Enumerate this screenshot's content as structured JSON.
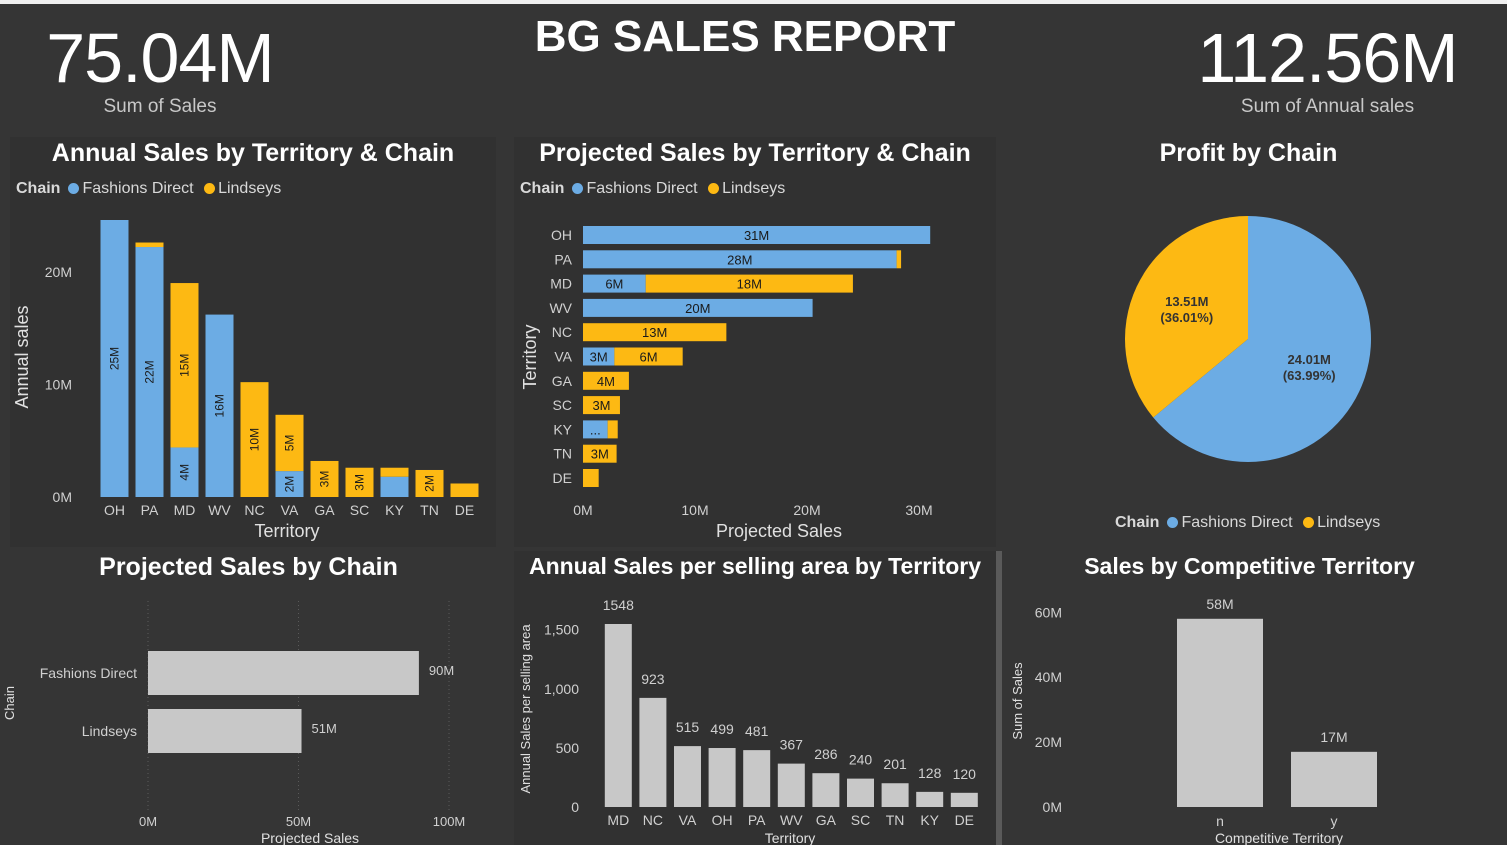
{
  "header": {
    "title": "BG SALES REPORT",
    "kpi_left": {
      "value": "75.04M",
      "label": "Sum of Sales"
    },
    "kpi_right": {
      "value": "112.56M",
      "label": "Sum of Annual sales"
    }
  },
  "colors": {
    "fashions_direct": "#6cace4",
    "lindseys": "#fdb913",
    "grey_bar": "#c8c8c8",
    "panel": "#313131",
    "page": "#353535"
  },
  "legend": {
    "title": "Chain",
    "items": [
      "Fashions Direct",
      "Lindseys"
    ]
  },
  "chart_data": [
    {
      "id": "annual",
      "type": "bar",
      "title": "Annual Sales by Territory & Chain",
      "xlabel": "Territory",
      "ylabel": "Annual sales",
      "ylim": [
        0,
        24.6
      ],
      "y_ticks": [
        "0M",
        "10M",
        "20M"
      ],
      "categories": [
        "OH",
        "PA",
        "MD",
        "WV",
        "NC",
        "VA",
        "GA",
        "SC",
        "KY",
        "TN",
        "DE"
      ],
      "series": [
        {
          "name": "Fashions Direct",
          "values": [
            24.6,
            22.2,
            4.4,
            16.2,
            0,
            2.3,
            0,
            0,
            1.8,
            0,
            0
          ],
          "labels": [
            "25M",
            "22M",
            "4M",
            "16M",
            "",
            "2M",
            "",
            "",
            "",
            "",
            ""
          ]
        },
        {
          "name": "Lindseys",
          "values": [
            0,
            0.4,
            14.6,
            0,
            10.2,
            5.0,
            3.2,
            2.6,
            0.8,
            2.4,
            1.2
          ],
          "labels": [
            "",
            "",
            "15M",
            "",
            "10M",
            "5M",
            "3M",
            "3M",
            "",
            "2M",
            ""
          ]
        }
      ],
      "legend_position": "top-left"
    },
    {
      "id": "projected",
      "type": "bar",
      "orientation": "horizontal",
      "title": "Projected Sales by Territory & Chain",
      "xlabel": "Projected Sales",
      "ylabel": "Territory",
      "xlim": [
        0,
        30
      ],
      "x_ticks": [
        "0M",
        "10M",
        "20M",
        "30M"
      ],
      "categories": [
        "OH",
        "PA",
        "MD",
        "WV",
        "NC",
        "VA",
        "GA",
        "SC",
        "KY",
        "TN",
        "DE"
      ],
      "series": [
        {
          "name": "Fashions Direct",
          "values": [
            31,
            28,
            5.6,
            20.5,
            0,
            2.8,
            0,
            0,
            2.2,
            0,
            0
          ],
          "labels": [
            "31M",
            "28M",
            "6M",
            "20M",
            "",
            "3M",
            "",
            "",
            "...",
            "",
            ""
          ]
        },
        {
          "name": "Lindseys",
          "values": [
            0,
            0.4,
            18.5,
            0,
            12.8,
            6.1,
            4.1,
            3.3,
            0.9,
            3.0,
            1.4
          ],
          "labels": [
            "",
            "",
            "18M",
            "",
            "13M",
            "6M",
            "4M",
            "3M",
            "",
            "3M",
            ""
          ]
        }
      ],
      "legend_position": "top-left"
    },
    {
      "id": "profit",
      "type": "pie",
      "title": "Profit by Chain",
      "slices": [
        {
          "name": "Fashions Direct",
          "value": 24.01,
          "label": "24.01M",
          "pct": "(63.99%)"
        },
        {
          "name": "Lindseys",
          "value": 13.51,
          "label": "13.51M",
          "pct": "(36.01%)"
        }
      ],
      "legend_position": "bottom"
    },
    {
      "id": "proj_chain",
      "type": "bar",
      "orientation": "horizontal",
      "title": "Projected Sales by Chain",
      "xlabel": "Projected Sales",
      "ylabel": "Chain",
      "xlim": [
        0,
        100
      ],
      "x_ticks": [
        "0M",
        "50M",
        "100M"
      ],
      "categories": [
        "Fashions Direct",
        "Lindseys"
      ],
      "values": [
        90,
        51
      ],
      "labels": [
        "90M",
        "51M"
      ]
    },
    {
      "id": "per_area",
      "type": "bar",
      "title": "Annual Sales per selling area by Territory",
      "xlabel": "Territory",
      "ylabel": "Annual Sales per selling area",
      "ylim": [
        0,
        1548
      ],
      "y_ticks": [
        "0",
        "500",
        "1,000",
        "1,500"
      ],
      "categories": [
        "MD",
        "NC",
        "VA",
        "OH",
        "PA",
        "WV",
        "GA",
        "SC",
        "TN",
        "KY",
        "DE"
      ],
      "values": [
        1548,
        923,
        515,
        499,
        481,
        367,
        286,
        240,
        201,
        128,
        120
      ],
      "labels": [
        "1548",
        "923",
        "515",
        "499",
        "481",
        "367",
        "286",
        "240",
        "201",
        "128",
        "120"
      ]
    },
    {
      "id": "competitive",
      "type": "bar",
      "title": "Sales by Competitive Territory",
      "xlabel": "Competitive Territory",
      "ylabel": "Sum of Sales",
      "ylim": [
        0,
        60
      ],
      "y_ticks": [
        "0M",
        "20M",
        "40M",
        "60M"
      ],
      "categories": [
        "n",
        "y"
      ],
      "values": [
        58,
        17
      ],
      "labels": [
        "58M",
        "17M"
      ]
    }
  ]
}
